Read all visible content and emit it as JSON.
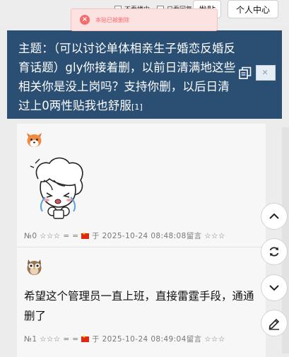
{
  "topbar": {
    "check1_label": "不看楼中",
    "check2_label": "只看回复",
    "btn_partial_label": "发贴",
    "personal_center_label": "个人中心"
  },
  "toast": {
    "message": "本贴已被删除"
  },
  "thread": {
    "title": "主题：（可以讨论单体相亲生子婚恋反婚反育话题）gly你接着删，以前日清满地这些相关你是没上岗吗？支持你删，以后日清过上0两性贴我也舒服",
    "reply_count": "[1]"
  },
  "posts": [
    {
      "meta_prefix": "№0 ☆☆☆ = =",
      "meta_time": "于 2025-10-24 08:48:08留言 ☆☆☆",
      "avatar": "fox-avatar",
      "sticker": "crying-cartoon-sticker"
    },
    {
      "meta_prefix": "№1 ☆☆☆ = =",
      "meta_time": "于 2025-10-24 08:49:04留言 ☆☆☆",
      "avatar": "owl-avatar",
      "text": "希望这个管理员一直上班，直接雷霆手段，通通删了"
    }
  ],
  "floating_buttons": [
    "chevron-up-icon",
    "refresh-icon",
    "chevron-down-icon",
    "edit-icon"
  ],
  "colors": {
    "header_bg": "#2a4f72",
    "toast_bg": "#fde2e2",
    "toast_text": "#f56c6c",
    "flag_red": "#de2910"
  }
}
